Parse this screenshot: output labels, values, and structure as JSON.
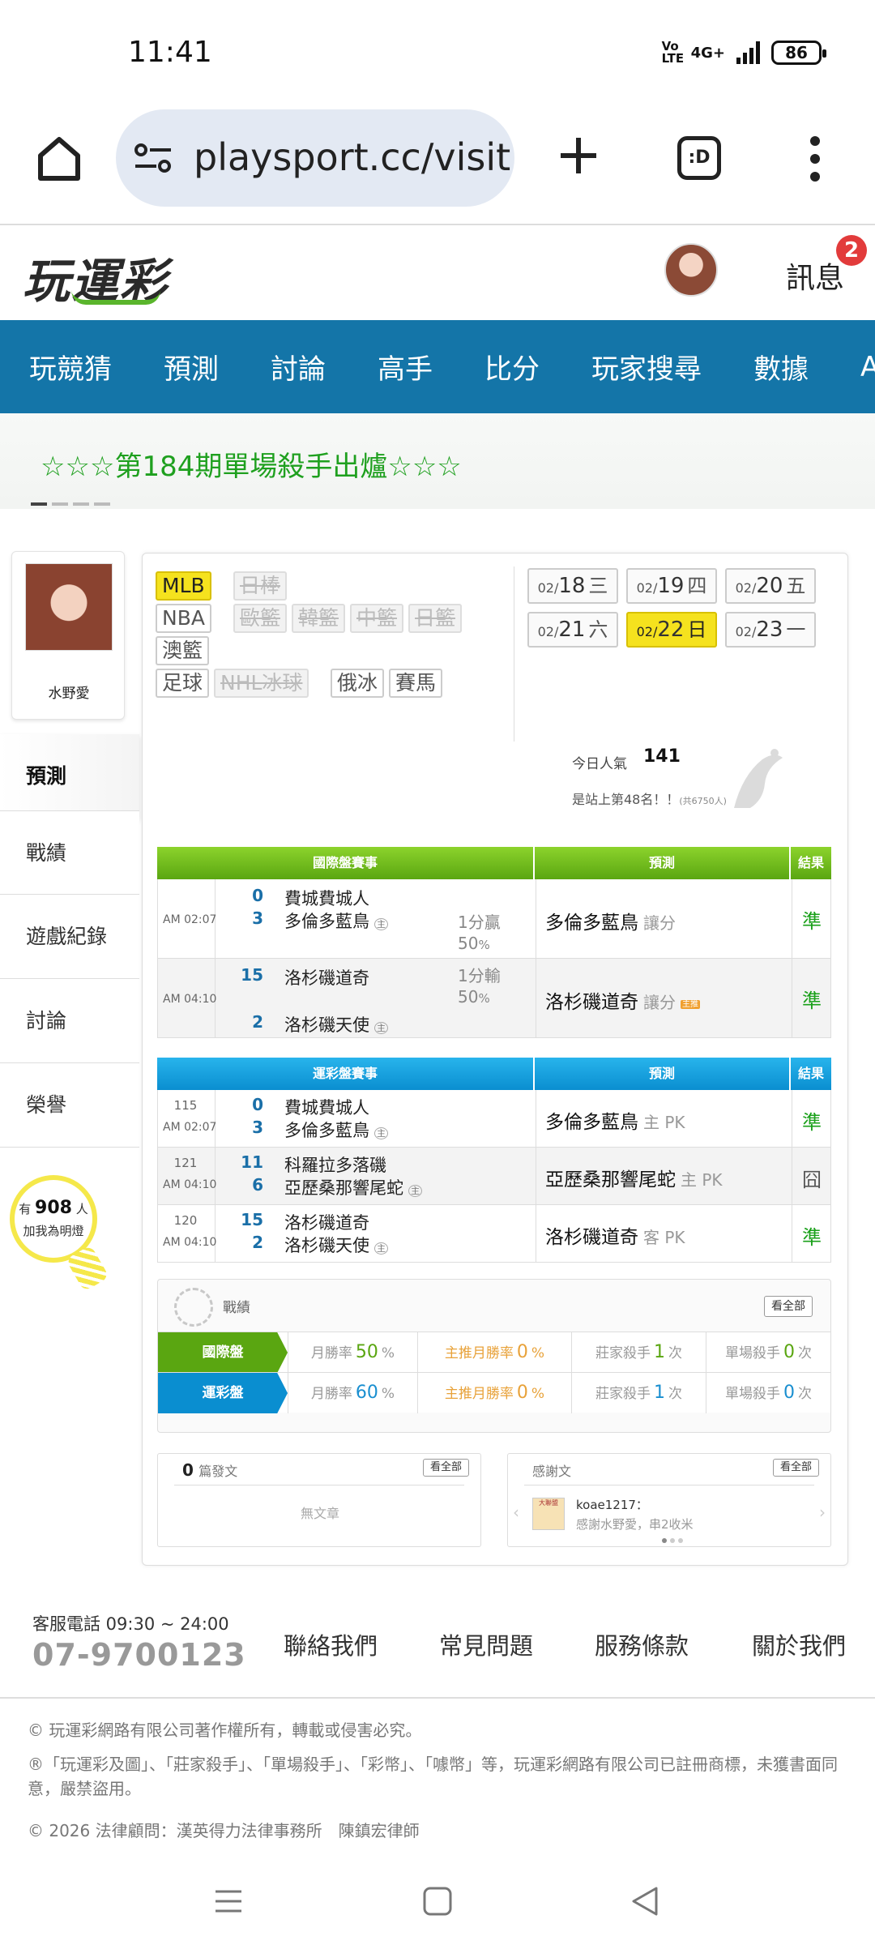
{
  "status_bar": {
    "time": "11:41",
    "network": "4G+",
    "volte": "Vo LTE",
    "battery": "86"
  },
  "browser": {
    "url": "playsport.cc/visit",
    "tabs_label": ":D"
  },
  "site_header": {
    "logo": "玩運彩",
    "message_label": "訊息",
    "message_count": "2"
  },
  "nav": {
    "items": [
      "玩競猜",
      "預測",
      "討論",
      "高手",
      "比分",
      "玩家搜尋",
      "數據",
      "APP"
    ]
  },
  "banner": {
    "text": "☆☆☆第184期單場殺手出爐☆☆☆"
  },
  "profile": {
    "name": "水野愛",
    "tabs": [
      "預測",
      "戰績",
      "遊戲紀錄",
      "討論",
      "榮譽"
    ],
    "light": {
      "prefix": "有",
      "count": "908",
      "suffix": "人",
      "caption": "加我為明燈"
    }
  },
  "leagues": {
    "row1": [
      {
        "label": "MLB",
        "state": "selected"
      },
      {
        "label": "日棒",
        "state": "disabled"
      }
    ],
    "row2": [
      {
        "label": "NBA",
        "state": "normal"
      },
      {
        "label": "歐籃",
        "state": "disabled"
      },
      {
        "label": "韓籃",
        "state": "disabled"
      },
      {
        "label": "中籃",
        "state": "disabled"
      },
      {
        "label": "日籃",
        "state": "disabled"
      }
    ],
    "row3": [
      {
        "label": "澳籃",
        "state": "normal"
      }
    ],
    "row4": [
      {
        "label": "足球",
        "state": "normal"
      },
      {
        "label": "NHL冰球",
        "state": "disabled"
      },
      {
        "label": "俄冰",
        "state": "normal"
      },
      {
        "label": "賽馬",
        "state": "normal"
      }
    ]
  },
  "dates": [
    {
      "month": "02/",
      "day": "18",
      "weekday": "三",
      "selected": false
    },
    {
      "month": "02/",
      "day": "19",
      "weekday": "四",
      "selected": false
    },
    {
      "month": "02/",
      "day": "20",
      "weekday": "五",
      "selected": false
    },
    {
      "month": "02/",
      "day": "21",
      "weekday": "六",
      "selected": false
    },
    {
      "month": "02/",
      "day": "22",
      "weekday": "日",
      "selected": true
    },
    {
      "month": "02/",
      "day": "23",
      "weekday": "一",
      "selected": false
    }
  ],
  "popularity": {
    "label": "今日人氣",
    "count": "141",
    "rank": "是站上第48名！！",
    "rank_note": "(共6750人)"
  },
  "intl_table": {
    "headers": [
      "國際盤賽事",
      "預測",
      "結果"
    ],
    "rows": [
      {
        "time": "AM 02:07",
        "away_score": "0",
        "away_team": "費城費城人",
        "home_score": "3",
        "home_team": "多倫多藍鳥",
        "home_mark": "主",
        "handicap": "1分贏",
        "handicap_pct": "50",
        "pct_sign": "%",
        "pick": "多倫多藍鳥",
        "pick_note": "讓分",
        "result": "準"
      },
      {
        "time": "AM 04:10",
        "away_score": "15",
        "away_team": "洛杉磯道奇",
        "home_score": "2",
        "home_team": "洛杉磯天使",
        "home_mark": "主",
        "handicap": "1分輸",
        "handicap_pct": "50",
        "pct_sign": "%",
        "pick": "洛杉磯道奇",
        "pick_note": "讓分",
        "pick_badge": "主推",
        "result": "準"
      }
    ]
  },
  "local_table": {
    "headers": [
      "運彩盤賽事",
      "預測",
      "結果"
    ],
    "rows": [
      {
        "num": "115",
        "time": "AM 02:07",
        "away_score": "0",
        "away_team": "費城費城人",
        "home_score": "3",
        "home_team": "多倫多藍鳥",
        "home_mark": "主",
        "pick": "多倫多藍鳥",
        "pick_note": "主 PK",
        "result": "準"
      },
      {
        "num": "121",
        "time": "AM 04:10",
        "away_score": "11",
        "away_team": "科羅拉多落磯",
        "home_score": "6",
        "home_team": "亞歷桑那響尾蛇",
        "home_mark": "主",
        "pick": "亞歷桑那響尾蛇",
        "pick_note": "主 PK",
        "result": "囧"
      },
      {
        "num": "120",
        "time": "AM 04:10",
        "away_score": "15",
        "away_team": "洛杉磯道奇",
        "home_score": "2",
        "home_team": "洛杉磯天使",
        "home_mark": "主",
        "pick": "洛杉磯道奇",
        "pick_note": "客 PK",
        "result": "準"
      }
    ]
  },
  "record": {
    "title": "戰績",
    "view_all": "看全部",
    "rows": [
      {
        "label": "國際盤",
        "month_rate_label": "月勝率",
        "month_rate": "50",
        "pct": "%",
        "main_rate_label": "主推月勝率",
        "main_rate": "0",
        "banker_label": "莊家殺手",
        "banker": "1",
        "times": "次",
        "single_label": "單場殺手",
        "single": "0"
      },
      {
        "label": "運彩盤",
        "month_rate_label": "月勝率",
        "month_rate": "60",
        "pct": "%",
        "main_rate_label": "主推月勝率",
        "main_rate": "0",
        "banker_label": "莊家殺手",
        "banker": "1",
        "times": "次",
        "single_label": "單場殺手",
        "single": "0"
      }
    ]
  },
  "posts": {
    "count": "0",
    "label": "篇發文",
    "view_all": "看全部",
    "empty": "無文章"
  },
  "thanks": {
    "label": "感謝文",
    "view_all": "看全部",
    "user": "koae1217：",
    "text": "感謝水野愛，串2收米",
    "avatar_text": "大聯盟"
  },
  "footer": {
    "service_label": "客服電話 09:30 ~ 24:00",
    "phone": "07-9700123",
    "links": [
      "聯絡我們",
      "常見問題",
      "服務條款",
      "關於我們"
    ],
    "copyright": "© 玩運彩網路有限公司著作權所有，轉載或侵害必究。",
    "trademark": "®「玩運彩及圖」、「莊家殺手」、「單場殺手」、「彩幣」、「噱幣」等，玩運彩網路有限公司已註冊商標，未獲書面同意，嚴禁盜用。",
    "legal": "© 2026 法律顧問：漢英得力法律事務所　陳鎮宏律師"
  },
  "colors": {
    "nav_bg": "#1475a8",
    "green": "#5aa611",
    "blue": "#0a8ed0",
    "yellow": "#f5e21e",
    "banner_green": "#1fa01f"
  }
}
